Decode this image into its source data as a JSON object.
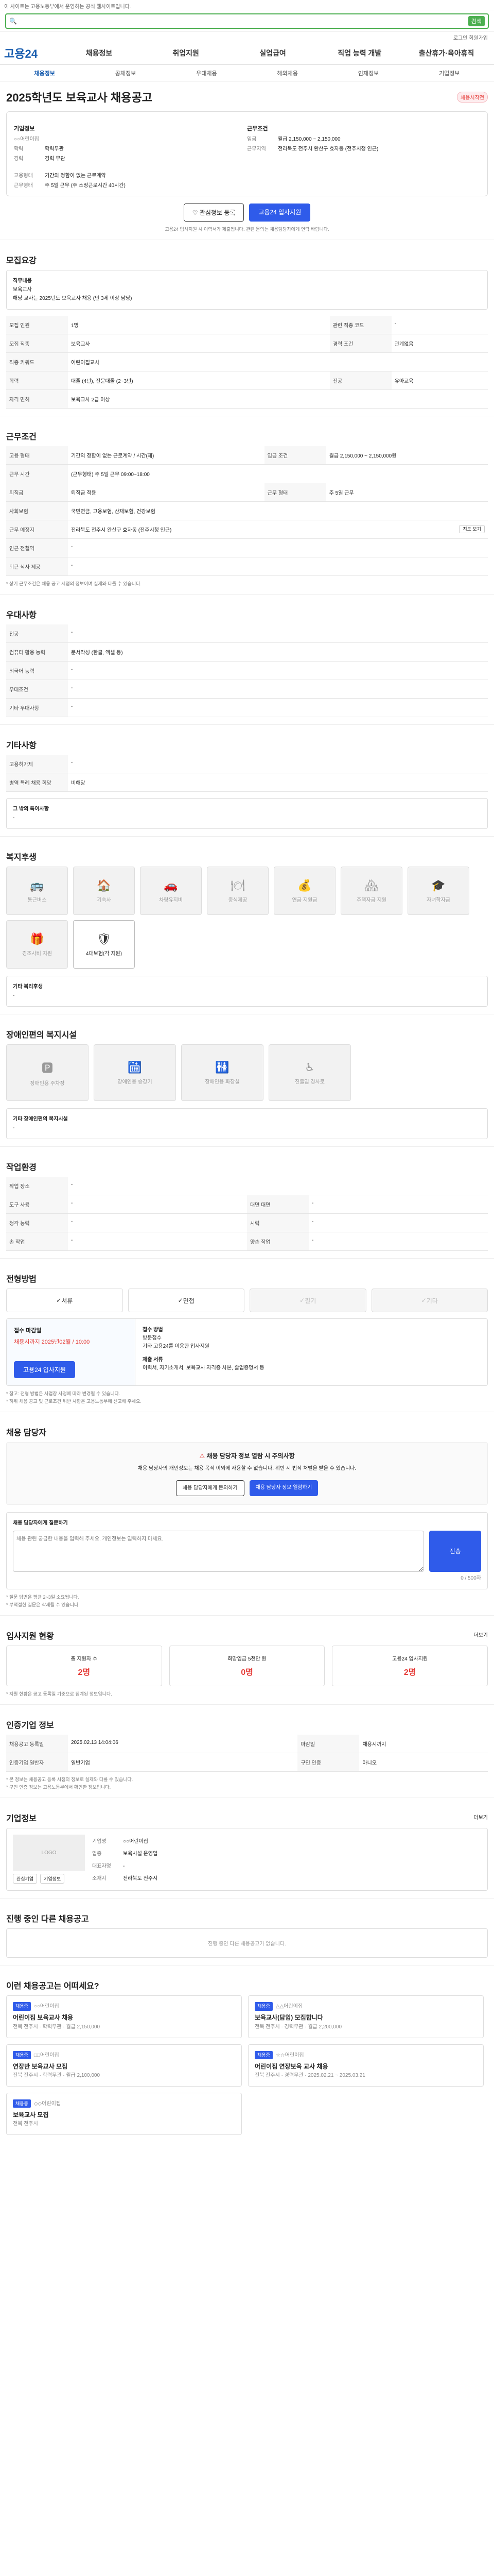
{
  "top": {
    "notice": "이 사이트는 고용노동부에서 운영하는 공식 웹사이트입니다."
  },
  "search": {
    "button": "검색"
  },
  "util": {
    "links": "로그인 회원가입"
  },
  "gnb": {
    "logo": "고용24",
    "items": [
      "채용정보",
      "취업지원",
      "실업급여",
      "직업 능력 개발",
      "출산휴가·육아휴직"
    ]
  },
  "subnav": [
    "채용정보",
    "공채정보",
    "우대채용",
    "해외채용",
    "인재정보",
    "기업정보"
  ],
  "job": {
    "title": "2025학년도 보육교사 채용공고",
    "status": "채용시작전",
    "company_label": "기업정보",
    "company": "○○어린이집",
    "work_cond_label": "근무조건",
    "period_label": "임금",
    "wage": "월급 2,150,000 ~ 2,150,000",
    "location_label": "근무지역",
    "location": "전라북도 전주시 완산구 효자동 (전주시청 인근)",
    "edu_label": "학력",
    "edu": "학력무관",
    "career_label": "경력",
    "career": "경력 무관",
    "type_label": "고용형태",
    "type": "기간의 정함이 없는 근로계약",
    "hours_label": "근무형태",
    "hours": "주 5일 근무 (주 소정근로시간 40시간)",
    "btn_scrap": "관심정보 등록",
    "btn_apply": "고용24 입사지원",
    "note": "고용24 입사지원 시 이력서가 제출됩니다. 관련 문의는 채용담당자에게 연락 바랍니다."
  },
  "recruit": {
    "title": "모집요강",
    "duty_label": "직무내용",
    "duty": "보육교사",
    "duty_desc": "해당 교사는 2025년도 보육교사 채용 (만 3세 이상 담당)",
    "rows": [
      {
        "k": "모집 인원",
        "v": "1명",
        "k2": "관련 직종 코드",
        "v2": "-"
      },
      {
        "k": "모집 직종",
        "v": "보육교사",
        "k2": "경력 조건",
        "v2": "관계없음"
      },
      {
        "k": "직종 키워드",
        "v": "어린이집교사",
        "k2": "",
        "v2": ""
      },
      {
        "k": "학력",
        "v": "대졸 (4년), 전문대졸 (2~3년)",
        "k2": "전공",
        "v2": "유아교육"
      },
      {
        "k": "자격 면허",
        "v": "보육교사 2급 이상",
        "k2": "",
        "v2": ""
      }
    ]
  },
  "workcond": {
    "title": "근무조건",
    "rows": [
      {
        "k": "고용 형태",
        "v": "기간의 정함이 없는 근로계약 / 시간(제)",
        "k2": "임금 조건",
        "v2": "월급 2,150,000 ~ 2,150,000원"
      },
      {
        "k": "근무 시간",
        "v": "(근무형태) 주 5일 근무 09:00~18:00",
        "k2": "",
        "v2": ""
      },
      {
        "k": "퇴직금",
        "v": "퇴직금 적용",
        "k2": "근무 형태",
        "v2": "주 5일 근무"
      },
      {
        "k": "사회보험",
        "v": "국민연금, 고용보험, 산재보험, 건강보험",
        "k2": "",
        "v2": ""
      },
      {
        "k": "근무 예정지",
        "v": "전라북도 전주시 완산구 효자동 (전주시청 인근)",
        "k2": "",
        "v2": ""
      },
      {
        "k": "인근 전철역",
        "v": "-",
        "k2": "",
        "v2": ""
      },
      {
        "k": "퇴근 식사 제공",
        "v": "-",
        "k2": "",
        "v2": ""
      }
    ],
    "map_btn": "지도 보기",
    "footnote": "* 상기 근무조건은 채용 공고 시점의 정보이며 실제와 다를 수 있습니다."
  },
  "pref": {
    "title": "우대사항",
    "rows": [
      {
        "k": "전공",
        "v": "-"
      },
      {
        "k": "컴퓨터 활용 능력",
        "v": "문서작성 (한글, 엑셀 등)"
      },
      {
        "k": "외국어 능력",
        "v": "-"
      },
      {
        "k": "우대조건",
        "v": "-"
      },
      {
        "k": "기타 우대사항",
        "v": "-"
      }
    ]
  },
  "etc": {
    "title": "기타사항",
    "rows": [
      {
        "k": "고용허가제",
        "v": "-"
      },
      {
        "k": "병역 특례 채용 희망",
        "v": "비해당"
      }
    ],
    "extra_label": "그 밖의 특이사항",
    "extra": "-"
  },
  "welfare": {
    "title": "복지후생",
    "items": [
      {
        "label": "통근버스",
        "icon": "bus-icon",
        "glyph": "🚌",
        "on": false
      },
      {
        "label": "기숙사",
        "icon": "house-icon",
        "glyph": "🏠",
        "on": false
      },
      {
        "label": "차량유지비",
        "icon": "car-icon",
        "glyph": "🚗",
        "on": false
      },
      {
        "label": "중식제공",
        "icon": "meal-icon",
        "glyph": "🍽",
        "on": false
      },
      {
        "label": "연금 지원금",
        "icon": "money-icon",
        "glyph": "💰",
        "on": false
      },
      {
        "label": "주택자금 지원",
        "icon": "home-loan-icon",
        "glyph": "🏘",
        "on": false
      },
      {
        "label": "자녀학자금",
        "icon": "school-icon",
        "glyph": "🎓",
        "on": false
      },
      {
        "label": "경조사비 지원",
        "icon": "gift-icon",
        "glyph": "🎁",
        "on": false
      },
      {
        "label": "4대보험(각 지원)",
        "icon": "insurance-icon",
        "glyph": "🛡",
        "on": true
      }
    ],
    "other_label": "기타 복리후생",
    "other": "-"
  },
  "disab": {
    "title": "장애인편의 복지시설",
    "items": [
      {
        "label": "장애인용 주차장",
        "icon": "parking-icon",
        "glyph": "🅿"
      },
      {
        "label": "장애인용 승강기",
        "icon": "elevator-icon",
        "glyph": "🛗"
      },
      {
        "label": "장애인용 화장실",
        "icon": "restroom-icon",
        "glyph": "🚻"
      },
      {
        "label": "진출입 경사로",
        "icon": "ramp-icon",
        "glyph": "♿"
      }
    ],
    "other_label": "기타 장애인편의 복지시설",
    "other": "-"
  },
  "workenv": {
    "title": "작업환경",
    "rows": [
      {
        "k": "작업 장소",
        "v": "-",
        "k2": "",
        "v2": ""
      },
      {
        "k": "도구 사용",
        "v": "-",
        "k2": "대면 대면",
        "v2": "-"
      },
      {
        "k": "청각 능력",
        "v": "-",
        "k2": "시력",
        "v2": "-"
      },
      {
        "k": "손 작업",
        "v": "-",
        "k2": "양손 작업",
        "v2": "-"
      }
    ]
  },
  "process": {
    "title": "전형방법",
    "steps": [
      {
        "label": "서류",
        "on": true
      },
      {
        "label": "면접",
        "on": true
      },
      {
        "label": "필기",
        "on": false
      },
      {
        "label": "기타",
        "on": false
      }
    ],
    "period_label": "접수 마감일",
    "deadline": "채용시까지 2025년02월 / 10:00",
    "apply_btn": "고용24 입사지원",
    "method_label": "접수 방법",
    "method": "방문접수",
    "method_desc": "기타 고용24를 이용한 입사지원",
    "docs_label": "제출 서류",
    "docs": "이력서, 자기소개서, 보육교사 자격증 사본, 졸업증명서 등",
    "notes": [
      "* 참고: 전형 방법은 사업장 사정에 따라 변경될 수 있습니다.",
      "* 허위 채용 공고 및 근로조건 위반 사항은 고용노동부에 신고해 주세요."
    ]
  },
  "manager": {
    "title": "채용 담당자",
    "warn_title": "채용 담당자 정보 열람 시 주의사항",
    "warn_text": "채용 담당자의 개인정보는 채용 목적 이외에 사용할 수 없습니다. 위반 시 법적 처벌을 받을 수 있습니다.",
    "btn_one": "채용 담당자에게 문의하기",
    "btn_two": "채용 담당자 정보 열람하기",
    "inquiry_label": "채용 담당자에게 질문하기",
    "inquiry_placeholder": "채용 관련 궁금한 내용을 입력해 주세요. 개인정보는 입력하지 마세요.",
    "inquiry_btn": "전송",
    "char_count": "0 / 500자",
    "tips": [
      "* 질문 답변은 평균 2~3일 소요됩니다.",
      "* 부적절한 질문은 삭제될 수 있습니다."
    ]
  },
  "stats": {
    "title": "입사지원 현황",
    "more": "더보기",
    "note": "* 지원 현황은 공고 등록일 기준으로 집계된 정보입니다.",
    "items": [
      {
        "label": "총 지원자 수",
        "value": "2명"
      },
      {
        "label": "희망임금 5천만 원",
        "value": "0명"
      },
      {
        "label": "고용24 입사지원",
        "value": "2명"
      }
    ]
  },
  "regist": {
    "title": "인증기업 정보",
    "rows": [
      {
        "k": "채용공고 등록일",
        "v": "2025.02.13 14:04:06",
        "k2": "마감일",
        "v2": "채용시까지"
      },
      {
        "k": "인증기업 일반자",
        "v": "일반기업",
        "k2": "구인 인증",
        "v2": "아니오"
      }
    ],
    "more_btn": "지도 보기",
    "notes": [
      "* 본 정보는 채용공고 등록 시점의 정보로 실제와 다를 수 있습니다.",
      "* 구인 인증 정보는 고용노동부에서 확인한 정보입니다."
    ]
  },
  "biz": {
    "title": "기업정보",
    "more": "더보기",
    "logo_text": "LOGO",
    "btn_one": "관심기업",
    "btn_two": "기업정보",
    "rows": [
      {
        "k": "기업명",
        "v": "○○어린이집"
      },
      {
        "k": "업종",
        "v": "보육시설 운영업"
      },
      {
        "k": "대표자명",
        "v": "-"
      },
      {
        "k": "소재지",
        "v": "전라북도 전주시"
      }
    ]
  },
  "others": {
    "title": "진행 중인 다른 채용공고",
    "empty": "진행 중인 다른 채용공고가 없습니다."
  },
  "recommend": {
    "title": "이런 채용공고는 어떠세요?",
    "cards": [
      {
        "badge": "채용중",
        "company": "○○어린이집",
        "title": "어린이집 보육교사 채용",
        "meta": "전북 전주시 · 학력무관 · 월급 2,150,000"
      },
      {
        "badge": "채용중",
        "company": "△△어린이집",
        "title": "보육교사(담임) 모집합니다",
        "meta": "전북 전주시 · 경력무관 · 월급 2,200,000"
      },
      {
        "badge": "채용중",
        "company": "□□어린이집",
        "title": "연장반 보육교사 모집",
        "meta": "전북 전주시 · 학력무관 · 월급 2,100,000"
      },
      {
        "badge": "채용중",
        "company": "☆☆어린이집",
        "title": "어린이집 연장보육 교사 채용",
        "meta": "전북 전주시 · 경력무관 · 2025.02.21 ~ 2025.03.21"
      },
      {
        "badge": "채용중",
        "company": "◇◇어린이집",
        "title": "보육교사 모집",
        "meta": "전북 전주시"
      }
    ]
  }
}
